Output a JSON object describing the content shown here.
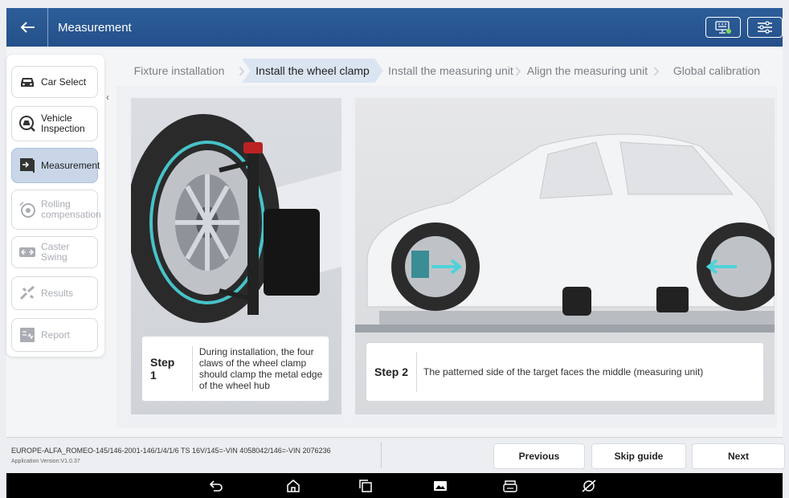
{
  "header": {
    "back_icon": "arrow-left-icon",
    "title": "Measurement",
    "right_icons": [
      "keyboard-vci-icon",
      "settings-sliders-icon"
    ]
  },
  "sidebar": {
    "items": [
      {
        "label": "Car Select",
        "icon": "car-icon",
        "state": "normal"
      },
      {
        "label": "Vehicle Inspection",
        "icon": "inspection-icon",
        "state": "normal"
      },
      {
        "label": "Measurement",
        "icon": "measurement-icon",
        "state": "active"
      },
      {
        "label": "Rolling compensation",
        "icon": "rolling-icon",
        "state": "disabled"
      },
      {
        "label": "Caster Swing",
        "icon": "caster-icon",
        "state": "disabled"
      },
      {
        "label": "Results",
        "icon": "results-icon",
        "state": "disabled"
      },
      {
        "label": "Report",
        "icon": "report-icon",
        "state": "disabled"
      }
    ],
    "collapse_icon": "chevron-left-icon"
  },
  "steps": [
    {
      "label": "Fixture installation",
      "active": false
    },
    {
      "label": "Install the wheel clamp",
      "active": true
    },
    {
      "label": "Install the measuring unit",
      "active": false
    },
    {
      "label": "Align the measuring unit",
      "active": false
    },
    {
      "label": "Global calibration",
      "active": false
    }
  ],
  "step1": {
    "num": "Step 1",
    "text": "During installation, the four claws of the wheel clamp should clamp the metal edge of the wheel hub"
  },
  "step2": {
    "num": "Step 2",
    "text": "The patterned side of the target faces the middle (measuring unit)"
  },
  "footer": {
    "vehicle_path": "EUROPE-ALFA_ROMEO-145/146-2001-146/1/4/1/6 TS 16V/145=-VIN 4058042/146=-VIN 2076236",
    "version": "Application Version:V1.0.37",
    "previous": "Previous",
    "skip": "Skip guide",
    "next": "Next"
  },
  "navbar": {
    "icons": [
      "back-icon",
      "home-icon",
      "recent-apps-icon",
      "gallery-icon",
      "vci-icon",
      "browser-icon"
    ]
  }
}
